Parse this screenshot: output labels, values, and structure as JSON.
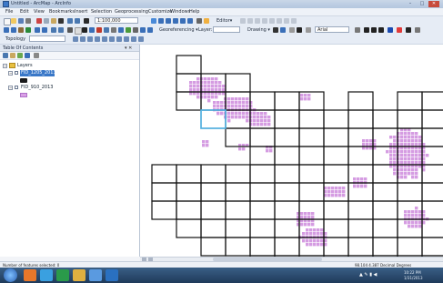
{
  "window": {
    "title": "Untitled - ArcMap - ArcInfo",
    "controls": [
      "–",
      "□",
      "✕"
    ]
  },
  "menubar": {
    "items": [
      "File",
      "Edit",
      "View",
      "Bookmarks",
      "Insert",
      "Selection",
      "Geoprocessing",
      "Customize",
      "Windows",
      "Help"
    ]
  },
  "toolbar1": {
    "scale_value": "1:100,000",
    "editor_label": "Editor▾"
  },
  "toolbar2": {
    "georeferencing_label": "Georeferencing ▾",
    "layer_combo": "Layer:",
    "drawing_label": "Drawing ▾",
    "font_combo": "Arial"
  },
  "toolbar3": {
    "topology_label": "Topology"
  },
  "toc": {
    "title": "Table Of Contents",
    "controls": "▾ ✕",
    "root": "Layers",
    "layers": [
      {
        "name": "FID_1205_2013",
        "selected": true,
        "swatch": "#1a1a1a"
      },
      {
        "name": "FID_910_2013",
        "selected": false,
        "swatch": "#d9a0e6"
      }
    ]
  },
  "status": {
    "left": "Number of features selected: 0",
    "right": "98.104  4.387 Decimal Degrees"
  },
  "taskbar": {
    "time": "10:22 PM",
    "date": "1/31/2013"
  },
  "colors": {
    "fill": "#d59ce2",
    "grid_line": "#111111",
    "selected_cell": "#54b6e8",
    "titlebar": "#b3c6de",
    "taskbar": "#284870"
  }
}
